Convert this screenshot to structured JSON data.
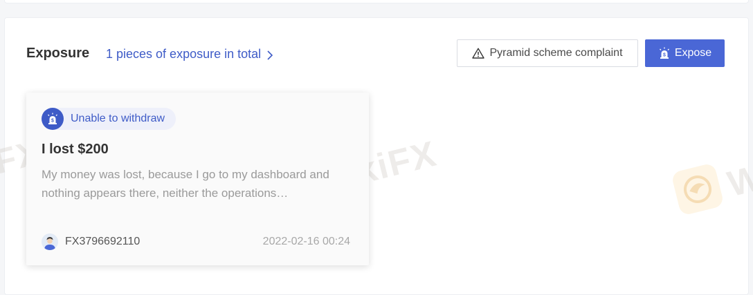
{
  "header": {
    "title": "Exposure",
    "summary_link": "1 pieces of exposure in total",
    "complaint_button": "Pyramid scheme complaint",
    "expose_button": "Expose"
  },
  "exposure_card": {
    "tag": "Unable to withdraw",
    "title": "I lost $200",
    "body": "My money was lost, because I go to my dashboard and nothing appears there, neither the operations…",
    "username": "FX3796692110",
    "timestamp": "2022-02-16 00:24"
  },
  "watermark": {
    "brand": "WikiFX",
    "fragment_left": "FX",
    "fragment_right": "W"
  },
  "colors": {
    "accent": "#3e5bc7",
    "button_primary": "#4a67d6",
    "tag_bg": "#eef0fa",
    "muted_text": "#9a9a9a"
  },
  "icons": {
    "summary_link": "chevron-right-icon",
    "complaint_button": "warning-triangle-icon",
    "expose_button": "alarm-siren-icon",
    "tag": "alarm-siren-icon",
    "avatar": "user-avatar-icon",
    "watermark": "eagle-logo-icon"
  }
}
